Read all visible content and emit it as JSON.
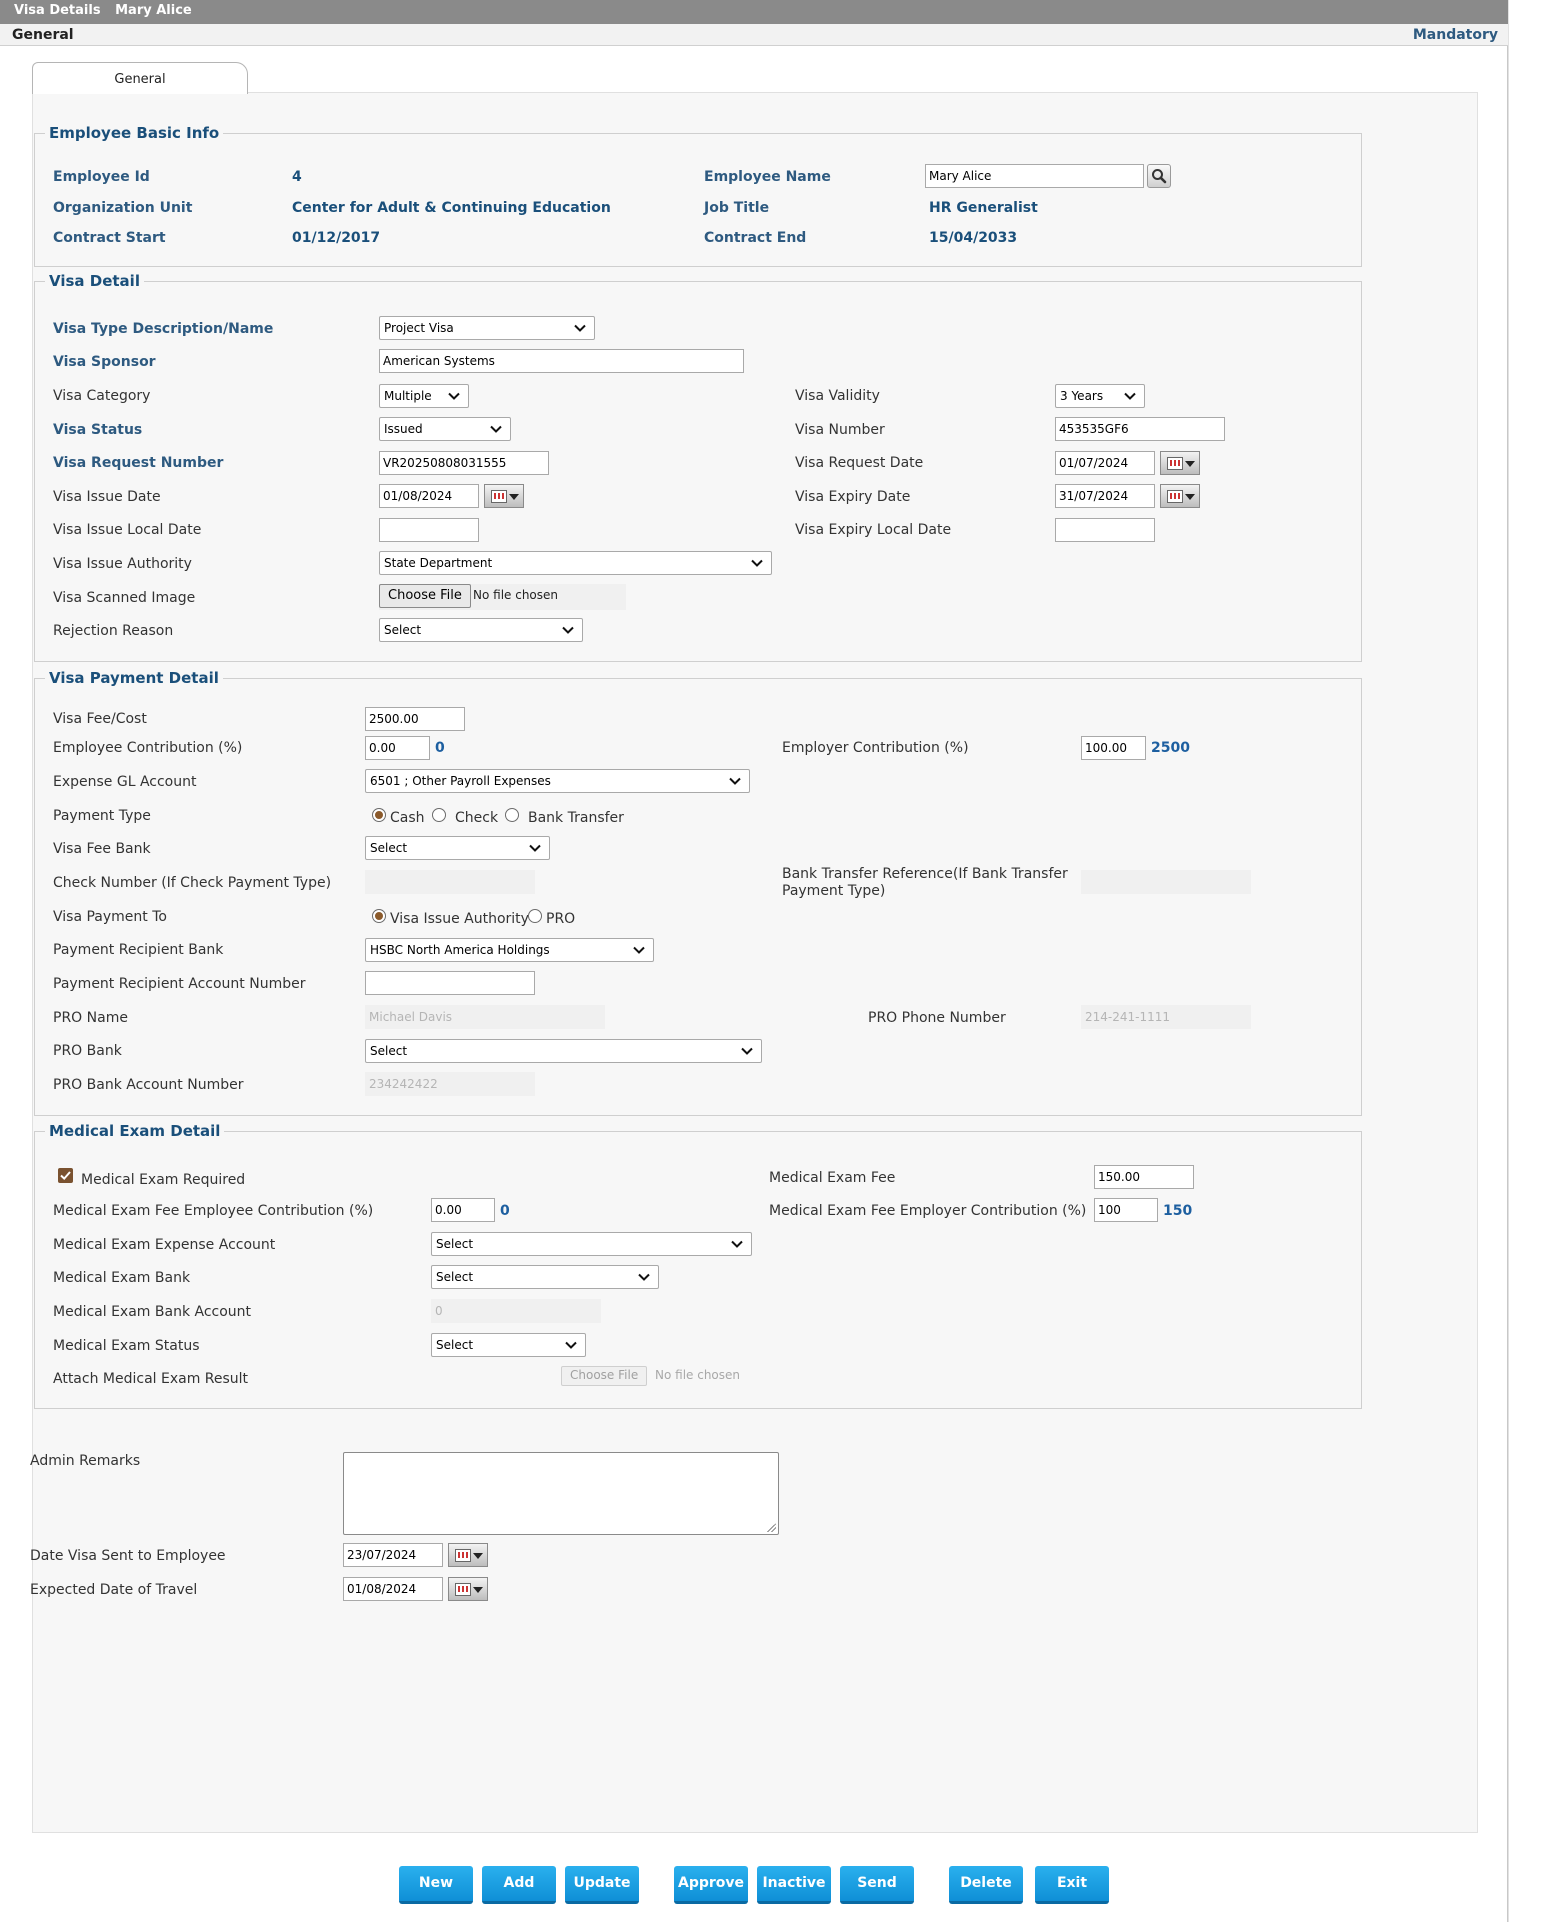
{
  "window": {
    "title": "Visa Details",
    "employee": "Mary Alice"
  },
  "subheader": {
    "section": "General",
    "mandatory": "Mandatory"
  },
  "tabs": [
    {
      "label": "General"
    }
  ],
  "basic_info": {
    "legend": "Employee Basic Info",
    "employee_id_label": "Employee Id",
    "employee_id": "4",
    "employee_name_label": "Employee Name",
    "employee_name": "Mary Alice",
    "org_unit_label": "Organization Unit",
    "org_unit": "Center for Adult & Continuing Education",
    "job_title_label": "Job Title",
    "job_title": "HR Generalist",
    "contract_start_label": "Contract Start",
    "contract_start": "01/12/2017",
    "contract_end_label": "Contract End",
    "contract_end": "15/04/2033"
  },
  "visa_detail": {
    "legend": "Visa Detail",
    "type_label": "Visa Type Description/Name",
    "type": "Project Visa",
    "sponsor_label": "Visa Sponsor",
    "sponsor": "American Systems",
    "category_label": "Visa Category",
    "category": "Multiple",
    "validity_label": "Visa Validity",
    "validity": "3 Years",
    "status_label": "Visa Status",
    "status": "Issued",
    "number_label": "Visa Number",
    "number": "453535GF6",
    "request_number_label": "Visa Request Number",
    "request_number": "VR20250808031555",
    "request_date_label": "Visa Request Date",
    "request_date": "01/07/2024",
    "issue_date_label": "Visa Issue Date",
    "issue_date": "01/08/2024",
    "expiry_date_label": "Visa Expiry Date",
    "expiry_date": "31/07/2024",
    "issue_local_date_label": "Visa Issue Local Date",
    "issue_local_date": "",
    "expiry_local_date_label": "Visa Expiry Local Date",
    "expiry_local_date": "",
    "issue_authority_label": "Visa Issue Authority",
    "issue_authority": "State Department",
    "scanned_image_label": "Visa Scanned Image",
    "choose_file": "Choose File",
    "no_file": "No file chosen",
    "rejection_reason_label": "Rejection Reason",
    "rejection_reason": "Select"
  },
  "payment": {
    "legend": "Visa Payment Detail",
    "fee_label": "Visa Fee/Cost",
    "fee": "2500.00",
    "emp_contrib_label": "Employee Contribution (%)",
    "emp_contrib": "0.00",
    "emp_contrib_amount": "0",
    "employer_contrib_label": "Employer Contribution (%)",
    "employer_contrib": "100.00",
    "employer_contrib_amount": "2500",
    "gl_account_label": "Expense GL Account",
    "gl_account": "6501 ; Other Payroll Expenses",
    "payment_type_label": "Payment Type",
    "pt_cash": "Cash",
    "pt_check": "Check",
    "pt_bank": "Bank Transfer",
    "fee_bank_label": "Visa Fee Bank",
    "fee_bank": "Select",
    "check_number_label": "Check Number (If Check Payment Type)",
    "check_number": "",
    "bank_ref_label_1": "Bank Transfer Reference(If Bank Transfer",
    "bank_ref_label_2": "Payment Type)",
    "bank_ref": "",
    "payment_to_label": "Visa Payment To",
    "pay_to_authority": "Visa Issue Authority",
    "pay_to_pro": "PRO",
    "recipient_bank_label": "Payment Recipient Bank",
    "recipient_bank": "HSBC North America Holdings",
    "recipient_account_label": "Payment Recipient Account Number",
    "recipient_account": "",
    "pro_name_label": "PRO Name",
    "pro_name": "Michael Davis",
    "pro_phone_label": "PRO Phone Number",
    "pro_phone": "214-241-1111",
    "pro_bank_label": "PRO Bank",
    "pro_bank": "Select",
    "pro_account_label": "PRO Bank Account Number",
    "pro_account": "234242422"
  },
  "medical": {
    "legend": "Medical Exam Detail",
    "required_label": "Medical Exam Required",
    "fee_label": "Medical Exam Fee",
    "fee": "150.00",
    "emp_contrib_label": "Medical Exam Fee Employee Contribution (%)",
    "emp_contrib": "0.00",
    "emp_contrib_amount": "0",
    "employer_contrib_label": "Medical Exam Fee Employer Contribution (%)",
    "employer_contrib": "100",
    "employer_contrib_amount": "150",
    "expense_account_label": "Medical Exam Expense Account",
    "expense_account": "Select",
    "bank_label": "Medical Exam Bank",
    "bank": "Select",
    "bank_account_label": "Medical Exam Bank Account",
    "bank_account": "0",
    "status_label": "Medical Exam Status",
    "status": "Select",
    "attach_label": "Attach Medical Exam Result",
    "choose_file": "Choose File",
    "no_file": "No file chosen"
  },
  "admin": {
    "remarks_label": "Admin Remarks",
    "remarks": "",
    "sent_label": "Date Visa Sent to Employee",
    "sent": "23/07/2024",
    "travel_label": "Expected Date of Travel",
    "travel": "01/08/2024"
  },
  "buttons": {
    "new": "New",
    "add": "Add",
    "update": "Update",
    "approve": "Approve",
    "inactive": "Inactive",
    "send": "Send",
    "delete": "Delete",
    "exit": "Exit"
  },
  "colors": {
    "title_bar": "#8a8a8a",
    "label_blue": "#2e5a80",
    "button": "#1ba3e6",
    "radio_checked": "#8b5a2b"
  }
}
